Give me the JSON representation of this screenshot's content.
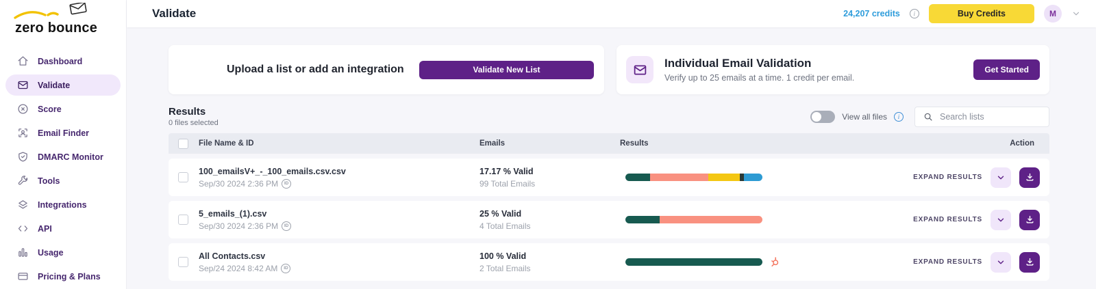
{
  "brand": {
    "logo_word_1": "zero",
    "logo_word_2": "bounce"
  },
  "sidebar": {
    "items": [
      {
        "label": "Dashboard"
      },
      {
        "label": "Validate"
      },
      {
        "label": "Score"
      },
      {
        "label": "Email Finder"
      },
      {
        "label": "DMARC Monitor"
      },
      {
        "label": "Tools"
      },
      {
        "label": "Integrations"
      },
      {
        "label": "API"
      },
      {
        "label": "Usage"
      },
      {
        "label": "Pricing & Plans"
      }
    ]
  },
  "header": {
    "page_title": "Validate",
    "credits_label": "24,207 credits",
    "buy_credits_label": "Buy Credits",
    "avatar_initial": "M"
  },
  "upload_card": {
    "title": "Upload a list or add an integration",
    "button_label": "Validate New List"
  },
  "individual_validation_card": {
    "title": "Individual Email Validation",
    "subtitle": "Verify up to 25 emails at a time. 1 credit per email.",
    "button_label": "Get Started"
  },
  "results_section": {
    "title": "Results",
    "files_selected": "0 files selected",
    "view_all_files_label": "View all files",
    "search_placeholder": "Search lists",
    "table": {
      "columns": [
        "File Name & ID",
        "Emails",
        "Results",
        "Action"
      ],
      "expand_results_label": "EXPAND RESULTS",
      "id_badge_label": "ID",
      "rows": [
        {
          "file_name": "100_emailsV+_-_100_emails.csv.csv",
          "date": "Sep/30 2024 2:36 PM",
          "valid_text": "17.17 % Valid",
          "total_text": "99 Total Emails",
          "segments": [
            {
              "color": "#175A50",
              "pct": 17.8
            },
            {
              "color": "#F99180",
              "pct": 42.5
            },
            {
              "color": "#F4C713",
              "pct": 23
            },
            {
              "color": "#2C3A36",
              "pct": 3
            },
            {
              "color": "#2E9BD3",
              "pct": 13.7
            }
          ]
        },
        {
          "file_name": "5_emails_(1).csv",
          "date": "Sep/30 2024 2:36 PM",
          "valid_text": "25 % Valid",
          "total_text": "4 Total Emails",
          "segments": [
            {
              "color": "#175A50",
              "pct": 25
            },
            {
              "color": "#F99180",
              "pct": 75
            }
          ]
        },
        {
          "file_name": "All Contacts.csv",
          "date": "Sep/24 2024 8:42 AM",
          "valid_text": "100 % Valid",
          "total_text": "2 Total Emails",
          "segments": [
            {
              "color": "#175A50",
              "pct": 100
            }
          ],
          "integration_icon": "hubspot"
        }
      ]
    }
  },
  "colors": {
    "accent_purple": "#5E2187",
    "buy_credits_yellow": "#F8D936",
    "credits_blue": "#2D9CDB",
    "valid_teal": "#175A50",
    "invalid_salmon": "#F99180",
    "catch_all_yellow": "#F4C713",
    "do_not_mail_dark": "#2C3A36",
    "unknown_blue": "#2E9BD3",
    "hubspot_orange": "#F4735C",
    "active_nav_bg": "#F1E8FB"
  }
}
